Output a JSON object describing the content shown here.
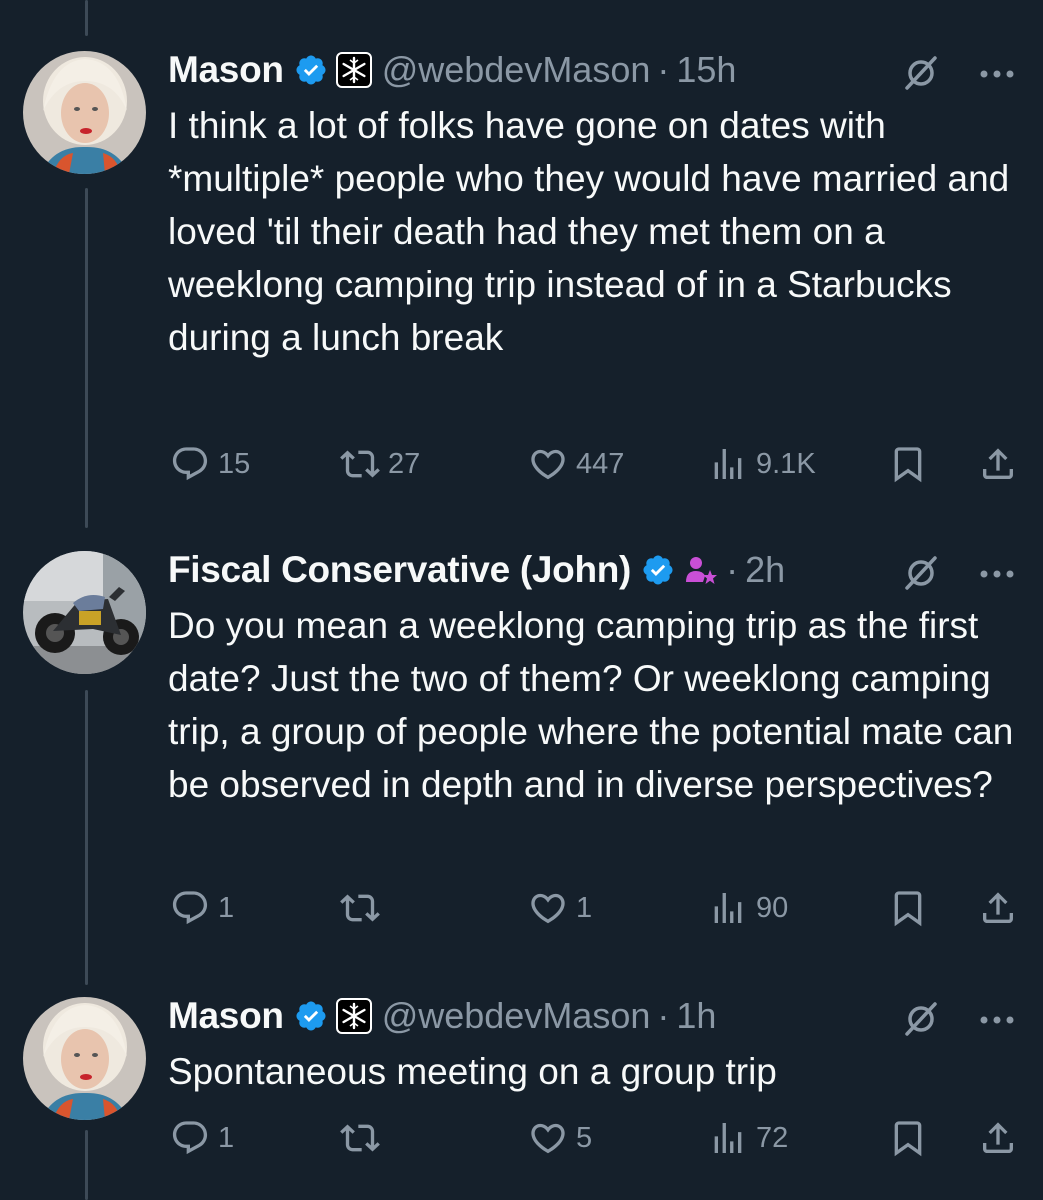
{
  "tweets": [
    {
      "name": "Mason",
      "handle": "@webdevMason",
      "time": "15h",
      "text": "I think a lot of folks have gone on dates with *multiple* people who they would have married and loved 'til their death had they met them on a weeklong camping trip instead of in a Starbucks during a lunch break",
      "replies": "15",
      "retweets": "27",
      "likes": "447",
      "views": "9.1K"
    },
    {
      "name": "Fiscal Conservative (John)",
      "handle": "",
      "time": "2h",
      "text": "Do you mean a weeklong camping trip as the first date? Just the two of them? Or weeklong camping trip, a group of people where the potential mate can be observed in depth and in diverse perspectives?",
      "replies": "1",
      "retweets": "",
      "likes": "1",
      "views": "90"
    },
    {
      "name": "Mason",
      "handle": "@webdevMason",
      "time": "1h",
      "text": "Spontaneous meeting on a group trip",
      "replies": "1",
      "retweets": "",
      "likes": "5",
      "views": "72"
    }
  ],
  "separator": "·",
  "colors": {
    "background": "#15202b",
    "text": "#f7f9f9",
    "muted": "#8b98a5",
    "verified": "#1d9bf0",
    "affiliate": "#c94fd6"
  },
  "icons": [
    "verified-badge-icon",
    "affiliate-badge-icon",
    "grok-icon",
    "more-icon",
    "reply-icon",
    "retweet-icon",
    "like-icon",
    "views-icon",
    "bookmark-icon",
    "share-icon"
  ]
}
